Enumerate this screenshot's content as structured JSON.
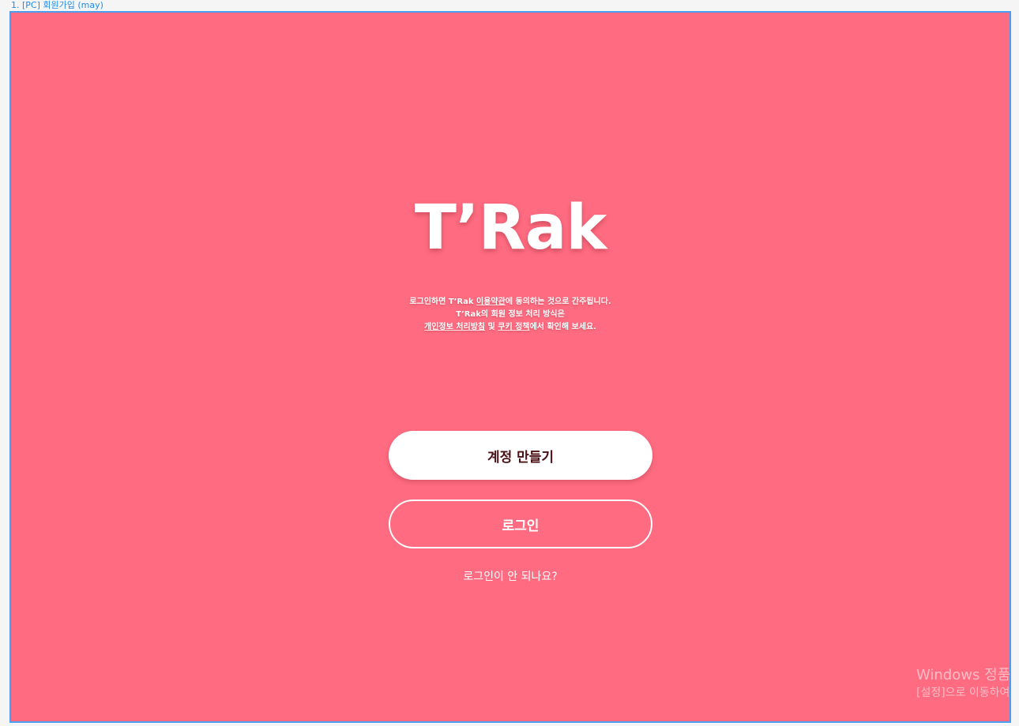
{
  "frame": {
    "label": "1. [PC] 회원가입 (may)",
    "background": "#ff6b80",
    "border_color": "#4a9df0"
  },
  "brand": {
    "logo_text": "T’Rak"
  },
  "terms": {
    "line1_prefix": "로그인하면 ",
    "line1_brand": "T’Rak",
    "line1_link": "이용약관",
    "line1_suffix": "에 동의하는 것으로 간주됩니다.",
    "line2_brand": "T’Rak",
    "line2_suffix": "의 회원 정보 처리 방식은",
    "line3_link1": "개인정보 처리방침",
    "line3_mid": " 및 ",
    "line3_link2": "쿠키 정책",
    "line3_suffix": "에서 확인해 보세요."
  },
  "actions": {
    "create_account_label": "계정 만들기",
    "login_label": "로그인",
    "trouble_label": "로그인이 안 되나요?"
  },
  "watermark": {
    "line1": "Windows 정품",
    "line2": "[설정]으로 이동하여"
  }
}
